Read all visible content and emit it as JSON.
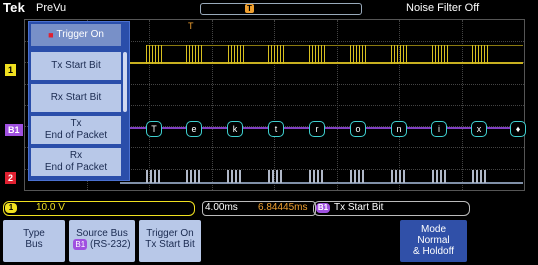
{
  "topbar": {
    "brand": "Tek",
    "mode": "PreVu",
    "trigger_marker": "T",
    "noise_filter": "Noise Filter Off"
  },
  "channels": {
    "ch1": "1",
    "bus": "B1",
    "ch2": "2"
  },
  "packet_chars": [
    "T",
    "e",
    "k",
    "t",
    "r",
    "o",
    "n",
    "i",
    "x",
    "♦"
  ],
  "menu": {
    "header": "Trigger On",
    "items": [
      {
        "line1": "Tx Start Bit",
        "line2": ""
      },
      {
        "line1": "Rx Start Bit",
        "line2": ""
      },
      {
        "line1": "Tx",
        "line2": "End of Packet"
      },
      {
        "line1": "Rx",
        "line2": "End of Packet"
      }
    ]
  },
  "readout": {
    "ch1_badge": "1",
    "ch1_value": "10.0 V",
    "timebase": "4.00ms",
    "time_position": "6.84445ms",
    "trigger_badge": "B1",
    "trigger_text": "Tx Start Bit"
  },
  "buttons": {
    "type": {
      "label": "Type",
      "value": "Bus"
    },
    "source_bus": {
      "label": "Source Bus",
      "badge": "B1",
      "value": "(RS-232)"
    },
    "trigger_on": {
      "label": "Trigger On",
      "value": "Tx Start Bit"
    },
    "mode": {
      "label": "Mode",
      "value1": "Normal",
      "value2": "& Holdoff"
    }
  },
  "colors": {
    "ch1": "#f0e020",
    "bus": "#a050e0",
    "ch2": "#e02030",
    "menu_bg": "#2a4eaa",
    "button_bg": "#b8c8e8"
  }
}
